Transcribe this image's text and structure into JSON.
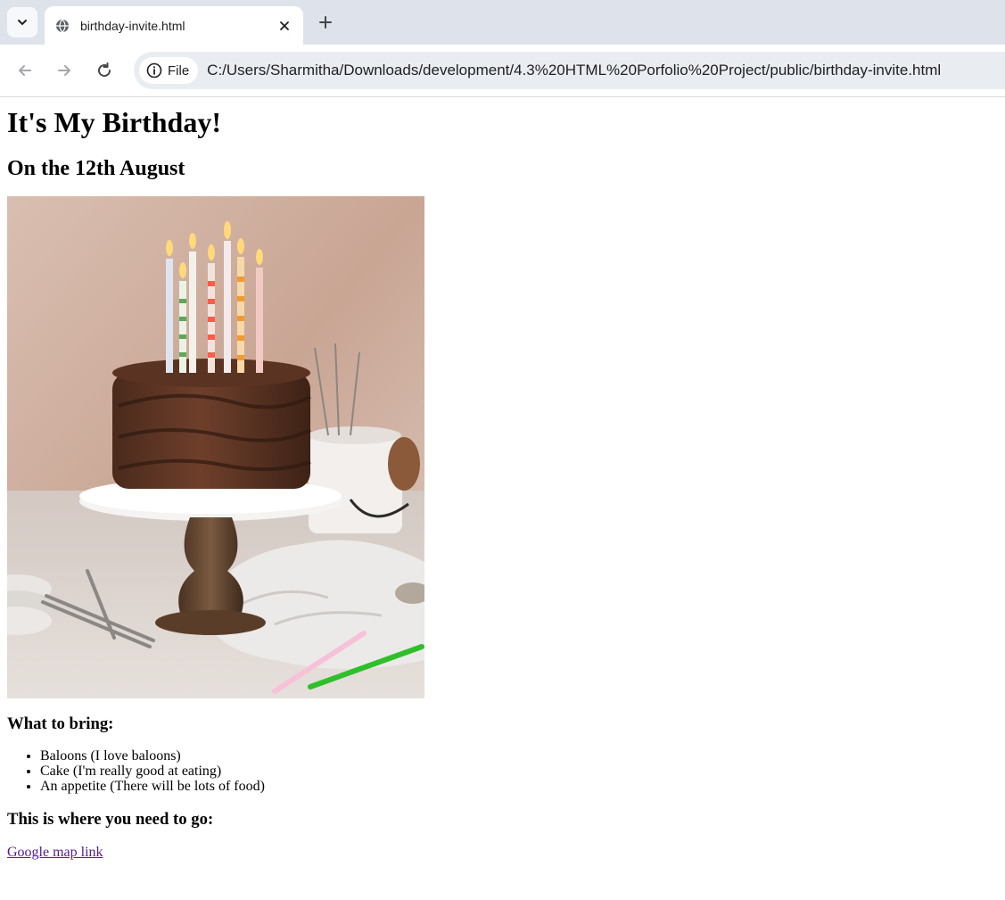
{
  "browser": {
    "tab_title": "birthday-invite.html",
    "site_chip_label": "File",
    "url": "C:/Users/Sharmitha/Downloads/development/4.3%20HTML%20Porfolio%20Project/public/birthday-invite.html",
    "icons": [
      "chevron-down-icon",
      "globe-icon",
      "close-icon",
      "plus-icon",
      "back-arrow-icon",
      "forward-arrow-icon",
      "reload-icon",
      "info-icon"
    ]
  },
  "page": {
    "heading": "It's My Birthday!",
    "date": "On the 12th August",
    "bring_heading": "What to bring:",
    "bring_items": [
      "Baloons (I love baloons)",
      "Cake (I'm really good at eating)",
      "An appetite (There will be lots of food)"
    ],
    "where_heading": "This is where you need to go:",
    "map_link": "Google map link",
    "link_color": "#551a8b"
  }
}
